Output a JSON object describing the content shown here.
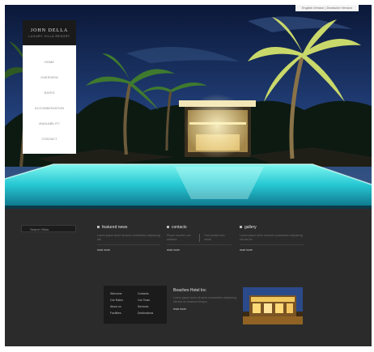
{
  "top_bar": {
    "links": "English Version | Deutsche Version"
  },
  "brand": {
    "name": "JOHN DELLA",
    "tagline": "LUXURY VILLA RESORT"
  },
  "nav": {
    "items": [
      {
        "label": "HOME"
      },
      {
        "label": "OVERVIEW"
      },
      {
        "label": "RATES"
      },
      {
        "label": "ACCOMMODATION"
      },
      {
        "label": "AVAILABILITY"
      },
      {
        "label": "CONTACT"
      }
    ]
  },
  "footer": {
    "search": {
      "placeholder": "Search Villas"
    },
    "featured": {
      "title": "featured news",
      "text": "Lorem ipsum dolor sit amet consectetur adipiscing elit",
      "link": "read more"
    },
    "contacts": {
      "title": "contacts",
      "text_left": "Phone number one address",
      "text_right": "Fax number two email",
      "link": "read more"
    },
    "gallery": {
      "title": "gallery",
      "text": "Lorem ipsum dolor sit amet consectetur adipiscing elit sed do",
      "link": "read more"
    },
    "sitemap": {
      "col1": [
        "Welcome",
        "Our Rates",
        "About us",
        "Facilities"
      ],
      "col2": [
        "Contacts",
        "Our Team",
        "Services",
        "Destinations"
      ]
    },
    "news": {
      "title": "Beaches Hotel Inc",
      "text": "Lorem ipsum dolor sit amet consectetur adipiscing elit sed do eiusmod tempor",
      "link": "read more"
    }
  },
  "colors": {
    "pool": "#3fe3e6",
    "sky": "#0e1f46",
    "footer_bg": "#2b2b2b"
  }
}
